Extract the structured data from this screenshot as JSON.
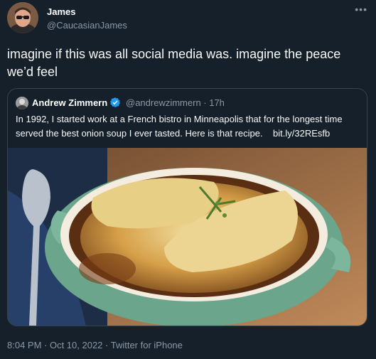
{
  "author": {
    "display_name": "James",
    "handle": "@CaucasianJames",
    "more_icon": "more-horizontal-icon"
  },
  "tweet": {
    "text": "imagine if this was all social media was. imagine the peace we’d feel"
  },
  "quoted": {
    "display_name": "Andrew Zimmern",
    "handle_time": "@andrewzimmern · 17h",
    "text": "In 1992, I started work at a French bistro in Minneapolis that for the longest time served the best onion soup I ever tasted. Here is that recipe.",
    "link": "bit.ly/32REsfb",
    "verified_icon": "verified-badge-icon",
    "verified_color": "#1d9bf0"
  },
  "meta": {
    "timestamp_source": "8:04 PM · Oct 10, 2022 · Twitter for iPhone"
  }
}
